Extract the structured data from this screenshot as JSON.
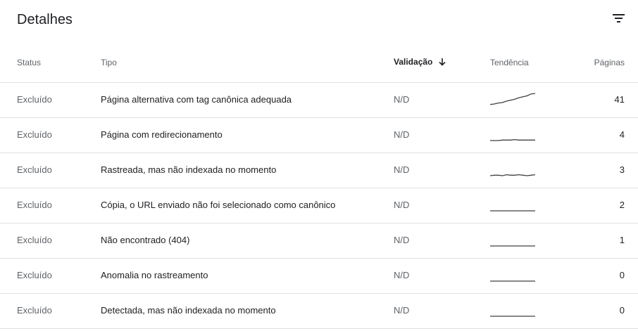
{
  "title": "Detalhes",
  "filter_icon": "filter-icon",
  "columns": {
    "status": "Status",
    "tipo": "Tipo",
    "validacao": "Validação",
    "tendencia": "Tendência",
    "paginas": "Páginas"
  },
  "sort_icon": "arrow-down-icon",
  "rows": [
    {
      "status": "Excluído",
      "tipo": "Página alternativa com tag canônica adequada",
      "validacao": "N/D",
      "paginas": "41",
      "trend": [
        2,
        3,
        5,
        6,
        9,
        11,
        13,
        16,
        18,
        20,
        24,
        25
      ]
    },
    {
      "status": "Excluído",
      "tipo": "Página com redirecionamento",
      "validacao": "N/D",
      "paginas": "4",
      "trend": [
        0,
        0,
        0,
        1,
        1,
        1,
        2,
        1,
        1,
        1,
        1,
        1
      ]
    },
    {
      "status": "Excluído",
      "tipo": "Rastreada, mas não indexada no momento",
      "validacao": "N/D",
      "paginas": "3",
      "trend": [
        0,
        1,
        1,
        0,
        2,
        1,
        1,
        2,
        1,
        0,
        1,
        2
      ]
    },
    {
      "status": "Excluído",
      "tipo": "Cópia, o URL enviado não foi selecionado como canônico",
      "validacao": "N/D",
      "paginas": "2",
      "trend": [
        0,
        0,
        0,
        0,
        0,
        0,
        0,
        0,
        0,
        0,
        0,
        0
      ]
    },
    {
      "status": "Excluído",
      "tipo": "Não encontrado (404)",
      "validacao": "N/D",
      "paginas": "1",
      "trend": [
        0,
        0,
        0,
        0,
        0,
        0,
        0,
        0,
        0,
        0,
        0,
        0
      ]
    },
    {
      "status": "Excluído",
      "tipo": "Anomalia no rastreamento",
      "validacao": "N/D",
      "paginas": "0",
      "trend": [
        0,
        0,
        0,
        0,
        0,
        0,
        0,
        0,
        0,
        0,
        0,
        0
      ]
    },
    {
      "status": "Excluído",
      "tipo": "Detectada, mas não indexada no momento",
      "validacao": "N/D",
      "paginas": "0",
      "trend": [
        0,
        0,
        0,
        0,
        0,
        0,
        0,
        0,
        0,
        0,
        0,
        0
      ]
    }
  ],
  "colors": {
    "text": "#202124",
    "muted": "#5f6368",
    "divider": "#e0e0e0",
    "sparkline": "#3c4043"
  }
}
